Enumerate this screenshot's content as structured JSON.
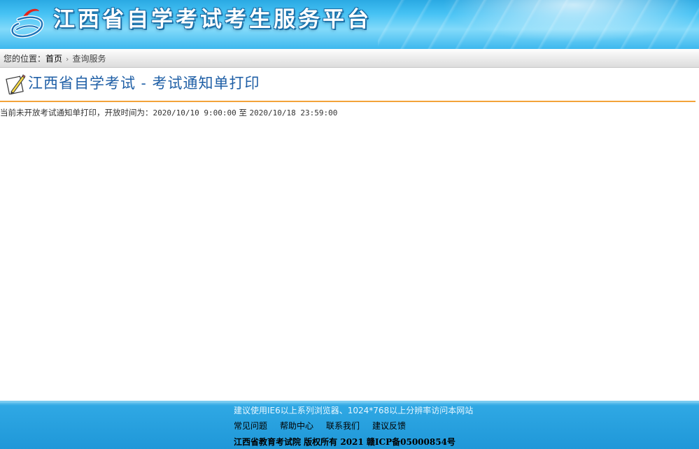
{
  "header": {
    "site_title": "江西省自学考试考生服务平台",
    "logo_icon": "jiangxi-zikao-logo-icon"
  },
  "breadcrumb": {
    "prefix": "您的位置：",
    "home": "首页",
    "separator": "›",
    "current": "查询服务"
  },
  "section": {
    "title": "江西省自学考试 - 考试通知单打印",
    "icon": "pencil-note-icon",
    "accent_color": "#f3a33a",
    "title_color": "#1f5fa6"
  },
  "notice": {
    "text": "当前未开放考试通知单打印，开放时间为：",
    "start": "2020/10/10 9:00:00",
    "to": "至",
    "end": "2020/10/18 23:59:00"
  },
  "footer": {
    "tip": "建议使用IE6以上系列浏览器、1024*768以上分辨率访问本网站",
    "links": [
      "常见问题",
      "帮助中心",
      "联系我们",
      "建议反馈"
    ],
    "copyright": "江西省教育考试院 版权所有 2021 赣ICP备05000854号"
  }
}
